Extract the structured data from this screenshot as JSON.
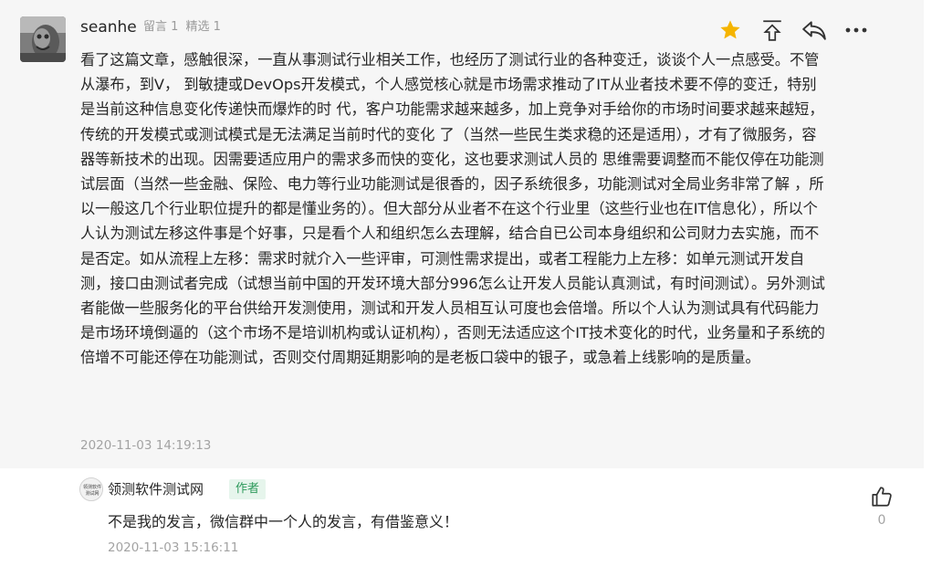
{
  "comment": {
    "username": "seanhe",
    "meta": {
      "replies": "留言 1",
      "featured": "精选 1"
    },
    "body": "看了这篇文章，感触很深，一直从事测试行业相关工作，也经历了测试行业的各种变迁，谈谈个人一点感受。不管从瀑布，到V， 到敏捷或DevOps开发模式，个人感觉核心就是市场需求推动了IT从业者技术要不停的变迁，特别是当前这种信息变化传递快而爆炸的时 代，客户功能需求越来越多，加上竞争对手给你的市场时间要求越来越短，传统的开发模式或测试模式是无法满足当前时代的变化 了（当然一些民生类求稳的还是适用），才有了微服务，容器等新技术的出现。因需要适应用户的需求多而快的变化，这也要求测试人员的 思维需要调整而不能仅停在功能测试层面（当然一些金融、保险、电力等行业功能测试是很香的，因子系统很多，功能测试对全局业务非常了解 ，所以一般这几个行业职位提升的都是懂业务的）。但大部分从业者不在这个行业里（这些行业也在IT信息化），所以个人认为测试左移这件事是个好事，只是看个人和组织怎么去理解，结合自已公司本身组织和公司财力去实施，而不是否定。如从流程上左移：需求时就介入一些评审，可测性需求提出，或者工程能力上左移：如单元测试开发自测，接口由测试者完成（试想当前中国的开发环境大部分996怎么让开发人员能认真测试，有时间测试）。另外测试者能做一些服务化的平台供给开发测使用，测试和开发人员相互认可度也会倍增。所以个人认为测试具有代码能力是市场环境倒逼的（这个市场不是培训机构或认证机构），否则无法适应这个IT技术变化的时代，业务量和子系统的倍增不可能还停在功能测试，否则交付周期延期影响的是老板口袋中的银子，或急着上线影响的是质量。",
    "time": "2020-11-03 14:19:13",
    "icons": [
      "star-icon",
      "pin-top-icon",
      "reply-icon",
      "more-icon"
    ],
    "colors": {
      "star": "#f5b400"
    }
  },
  "reply": {
    "author": "领测软件测试网",
    "avatar_text": [
      "领测软件",
      "测试网"
    ],
    "badge": "作者",
    "text": "不是我的发言，微信群中一个人的发言，有借鉴意义！",
    "time": "2020-11-03 15:16:11",
    "likes": "0",
    "colors": {
      "badge_bg": "#e6f5ec",
      "badge_text": "#2e9a5c"
    }
  }
}
